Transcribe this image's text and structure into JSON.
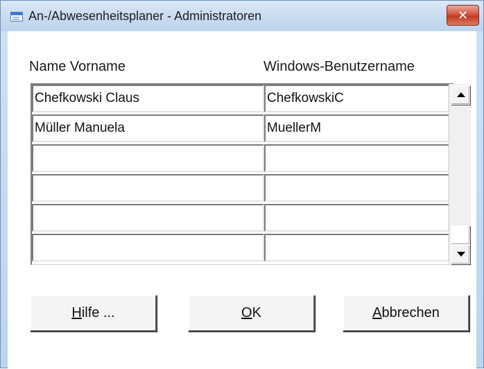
{
  "window": {
    "title": "An-/Abwesenheitsplaner - Administratoren",
    "close_glyph": "✕"
  },
  "table": {
    "headers": [
      "Name Vorname",
      "Windows-Benutzername"
    ],
    "rows": [
      {
        "name": "Chefkowski Claus",
        "username": "ChefkowskiC"
      },
      {
        "name": "Müller Manuela",
        "username": "MuellerM"
      },
      {
        "name": "",
        "username": ""
      },
      {
        "name": "",
        "username": ""
      },
      {
        "name": "",
        "username": ""
      },
      {
        "name": "",
        "username": ""
      }
    ]
  },
  "buttons": {
    "help": {
      "mnemonic": "H",
      "rest": "ilfe ..."
    },
    "ok": {
      "mnemonic": "O",
      "rest": "K"
    },
    "cancel": {
      "mnemonic": "A",
      "rest": "bbrechen"
    }
  },
  "icons": {
    "app": "app-window-icon",
    "scroll_up": "arrow-up-icon",
    "scroll_down": "arrow-down-icon"
  },
  "colors": {
    "title_bar": "#c9dcf1",
    "close_button": "#c23a22"
  }
}
